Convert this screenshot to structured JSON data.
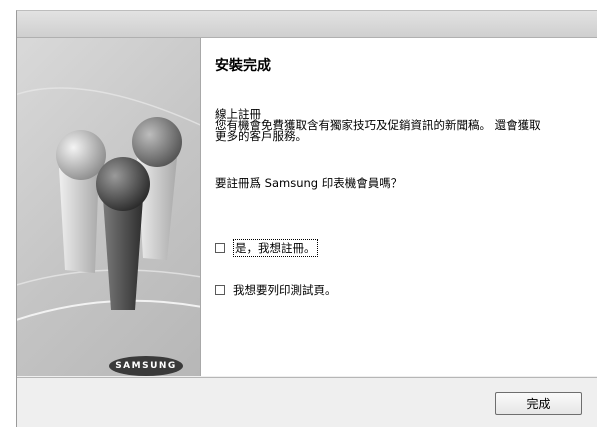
{
  "banner": {
    "logo_text": "SAMSUNG"
  },
  "content": {
    "heading": "安裝完成",
    "online_registration": {
      "title": "線上註冊",
      "line1": "您有機會免費獲取含有獨家技巧及促銷資訊的新聞稿。 還會獲取",
      "line2": "更多的客戶服務。"
    },
    "question": "要註冊爲 Samsung 印表機會員嗎？",
    "options": [
      {
        "label": "是，我想註冊。",
        "checked": false
      },
      {
        "label": "我想要列印測試頁。",
        "checked": false
      }
    ]
  },
  "footer": {
    "finish_label": "完成"
  },
  "colors": {
    "window_bg": "#efefef",
    "banner_bg": "#c4c4c4",
    "content_bg": "#ffffff"
  }
}
